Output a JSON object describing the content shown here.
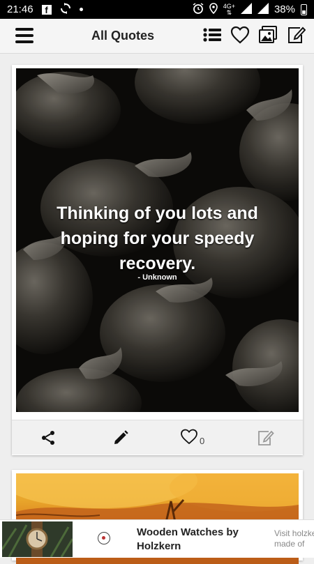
{
  "status_bar": {
    "time": "21:46",
    "facebook_icon_glyph": "f",
    "network_label": "4G+",
    "battery_percent": "38%",
    "icons": [
      "facebook-icon",
      "sync-icon",
      "notification-dot",
      "alarm-icon",
      "location-icon",
      "signal-icon",
      "battery-icon"
    ]
  },
  "app_bar": {
    "title": "All Quotes",
    "icons": [
      "menu-icon",
      "list-icon",
      "heart-icon",
      "gallery-icon",
      "edit-icon"
    ]
  },
  "quote_card": {
    "text": "Thinking of you lots and hoping for your speedy recovery.",
    "author": "- Unknown",
    "like_count": "0",
    "actions": [
      "share-icon",
      "pencil-icon",
      "heart-outline-icon",
      "edit-note-icon"
    ]
  },
  "ad": {
    "title": "Wooden Watches by Holzkern",
    "side_text_line1": "Visit holzke",
    "side_text_line2": "made of"
  },
  "colors": {
    "status_bar_bg": "#000000",
    "app_bar_bg": "#f5f5f5",
    "page_bg": "#eeeeee",
    "quote_text": "#ffffff"
  }
}
